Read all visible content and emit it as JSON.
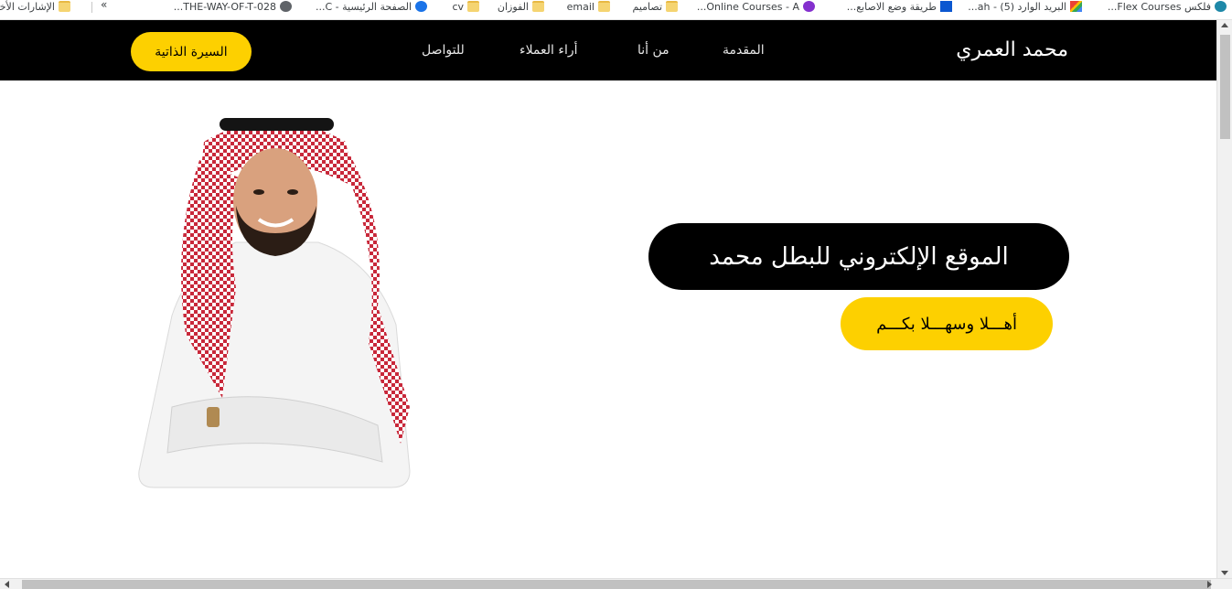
{
  "bookmarks": [
    {
      "label": "فلكس Flex Courses...",
      "icon": "flex-icon"
    },
    {
      "label": "البريد الوارد (5) - ah...",
      "icon": "gmail-icon"
    },
    {
      "label": "طريقة وضع الاصابع...",
      "icon": "h-icon"
    },
    {
      "label": "Online Courses - A...",
      "icon": "udemy-icon"
    },
    {
      "label": "تصاميم",
      "icon": "folder-icon"
    },
    {
      "label": "email",
      "icon": "folder-icon"
    },
    {
      "label": "الفوزان",
      "icon": "folder-icon"
    },
    {
      "label": "cv",
      "icon": "folder-icon"
    },
    {
      "label": "الصفحة الرئيسية - C...",
      "icon": "canva-icon"
    },
    {
      "label": "028-THE-WAY-OF-T...",
      "icon": "globe-icon"
    }
  ],
  "bookmarks_overflow": "»",
  "other_bookmarks": "الإشارات الأخرى",
  "nav": {
    "brand": "محمد العمري",
    "links": [
      "المقدمة",
      "من أنا",
      "أراء العملاء",
      "للتواصل"
    ],
    "cv_button": "السيرة الذاتية"
  },
  "hero": {
    "title": "الموقع الإلكتروني للبطل محمد",
    "subtitle": "أهـــلا وسهـــلا بكـــم"
  },
  "portrait": {
    "alt": "portrait-photo"
  },
  "colors": {
    "nav_bg": "#000000",
    "accent": "#fdd000",
    "text_light": "#ffffff"
  }
}
